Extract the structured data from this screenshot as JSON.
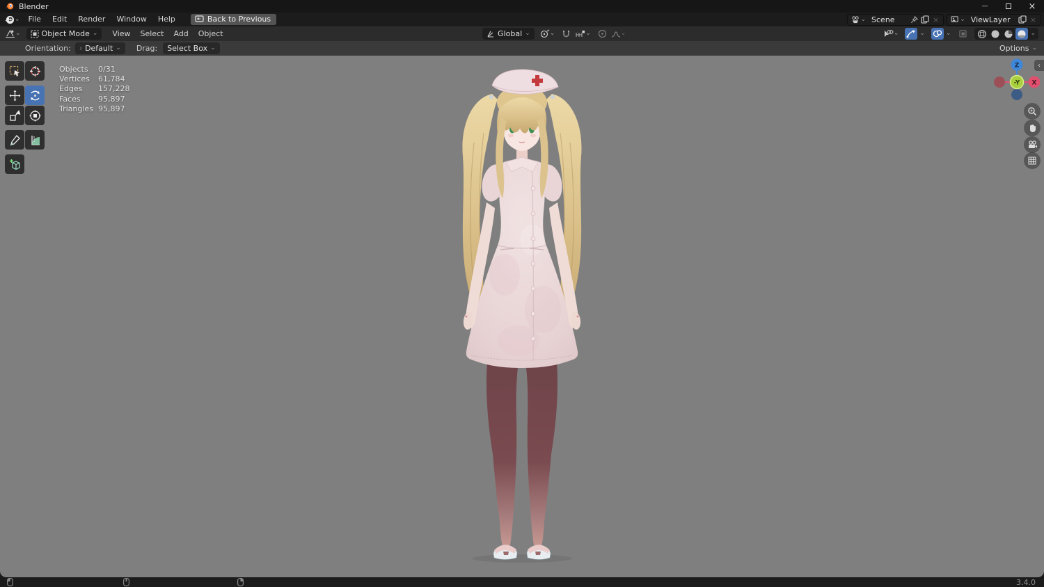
{
  "window": {
    "title": "Blender",
    "controls": {
      "minimize": "—",
      "maximize": "maximize-box",
      "close": "×"
    }
  },
  "topbar": {
    "menus": [
      "File",
      "Edit",
      "Render",
      "Window",
      "Help"
    ],
    "back_button": "Back to Previous",
    "scene": {
      "value": "Scene"
    },
    "view_layer": {
      "value": "ViewLayer"
    }
  },
  "viewport_header": {
    "mode": "Object Mode",
    "menus": [
      "View",
      "Select",
      "Add",
      "Object"
    ],
    "orientation": "Global"
  },
  "tool_settings": {
    "orientation_label": "Orientation:",
    "orientation_value": "Default",
    "drag_label": "Drag:",
    "drag_value": "Select Box",
    "options": "Options"
  },
  "stats": {
    "rows": [
      {
        "label": "Objects",
        "value": "0/31"
      },
      {
        "label": "Vertices",
        "value": "61,784"
      },
      {
        "label": "Edges",
        "value": "157,228"
      },
      {
        "label": "Faces",
        "value": "95,897"
      },
      {
        "label": "Triangles",
        "value": "95,897"
      }
    ]
  },
  "gizmo": {
    "axis_z": "Z",
    "axis_x": "X",
    "axis_front": "-Y"
  },
  "statusbar": {
    "version": "3.4.0"
  },
  "viewport": {
    "model_description": "Anime-style nurse character: blonde twin tails, green eyes, pink nurse cap with red cross, pale pink button-front uniform dress, dark red stockings, pink sandals"
  },
  "icons": {
    "chevron_down": "⌄",
    "collapse_left": "‹",
    "close_small": "×"
  },
  "colors": {
    "accent_blue": "#4772b3",
    "viewport_background": "#7f7f7f",
    "axis_x": "#e0506e",
    "axis_front_y": "#9bcc3c",
    "axis_z": "#3f87d9",
    "axis_neg_x": "#9b4f56",
    "axis_neg_z": "#3d5c85",
    "cross_red": "#c3393c"
  }
}
